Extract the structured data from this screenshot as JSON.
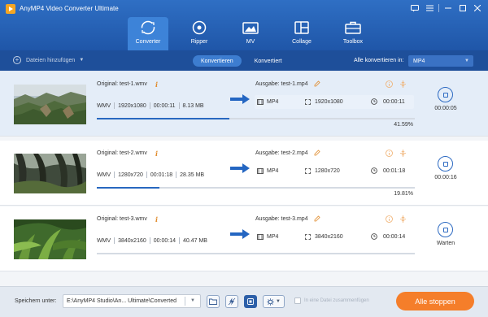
{
  "app": {
    "title": "AnyMP4 Video Converter Ultimate"
  },
  "nav": {
    "tabs": [
      {
        "label": "Converter",
        "icon": "refresh-icon",
        "active": true
      },
      {
        "label": "Ripper",
        "icon": "disc-icon",
        "active": false
      },
      {
        "label": "MV",
        "icon": "mv-image-icon",
        "active": false
      },
      {
        "label": "Collage",
        "icon": "collage-icon",
        "active": false
      },
      {
        "label": "Toolbox",
        "icon": "toolbox-icon",
        "active": false
      }
    ]
  },
  "toolbar": {
    "add_files_label": "Dateien hinzufügen",
    "tab_converting": "Konvertieren",
    "tab_converted": "Konvertiert",
    "convert_all_label": "Alle konvertieren in:",
    "format_value": "MP4"
  },
  "files": [
    {
      "original": "Original: test-1.wmv",
      "src_format": "WMV",
      "src_resolution": "1920x1080",
      "src_duration": "00:00:11",
      "src_size": "8.13 MB",
      "output": "Ausgabe: test-1.mp4",
      "out_format": "MP4",
      "out_resolution": "1920x1080",
      "out_duration": "00:00:11",
      "progress_percent": 41.59,
      "progress_label": "41.59%",
      "status": "00:00:05",
      "selected": true
    },
    {
      "original": "Original: test-2.wmv",
      "src_format": "WMV",
      "src_resolution": "1280x720",
      "src_duration": "00:01:18",
      "src_size": "28.35 MB",
      "output": "Ausgabe: test-2.mp4",
      "out_format": "MP4",
      "out_resolution": "1280x720",
      "out_duration": "00:01:18",
      "progress_percent": 19.81,
      "progress_label": "19.81%",
      "status": "00:00:16",
      "selected": false
    },
    {
      "original": "Original: test-3.wmv",
      "src_format": "WMV",
      "src_resolution": "3840x2160",
      "src_duration": "00:00:14",
      "src_size": "40.47 MB",
      "output": "Ausgabe: test-3.mp4",
      "out_format": "MP4",
      "out_resolution": "3840x2160",
      "out_duration": "00:00:14",
      "progress_percent": 0,
      "progress_label": "",
      "status": "Warten",
      "selected": false
    }
  ],
  "footer": {
    "save_label": "Speichern unter:",
    "save_path": "E:\\AnyMP4 Studio\\An... Ultimate\\Converted",
    "merge_label": "In eine Datei zusammenfügen",
    "stop_all_label": "Alle stoppen"
  },
  "colors": {
    "header": "#1f56a8",
    "accent": "#2868c0",
    "stop_button": "#f57e2a",
    "info": "#e08a2a"
  }
}
